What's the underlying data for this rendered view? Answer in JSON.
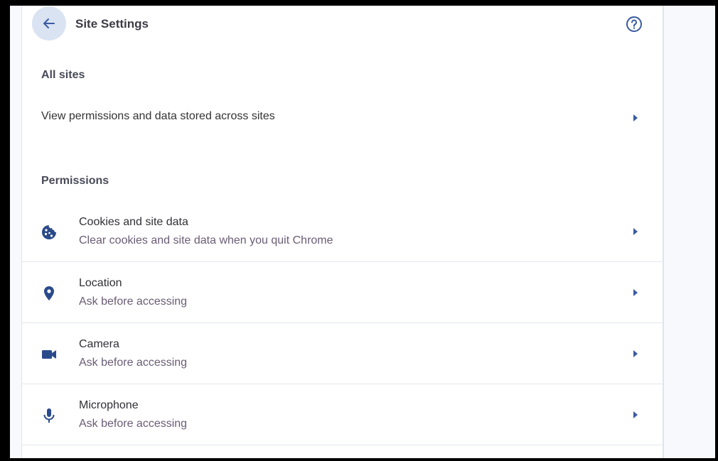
{
  "header": {
    "title": "Site Settings"
  },
  "all_sites": {
    "label": "All sites",
    "row_text": "View permissions and data stored across sites"
  },
  "permissions": {
    "label": "Permissions",
    "items": [
      {
        "title": "Cookies and site data",
        "subtitle": "Clear cookies and site data when you quit Chrome",
        "icon": "cookie-icon"
      },
      {
        "title": "Location",
        "subtitle": "Ask before accessing",
        "icon": "location-pin-icon"
      },
      {
        "title": "Camera",
        "subtitle": "Ask before accessing",
        "icon": "camera-icon"
      },
      {
        "title": "Microphone",
        "subtitle": "Ask before accessing",
        "icon": "microphone-icon"
      }
    ]
  },
  "colors": {
    "accent": "#3a5ba0",
    "card": "#ffffff",
    "background": "#f7f9fd"
  }
}
